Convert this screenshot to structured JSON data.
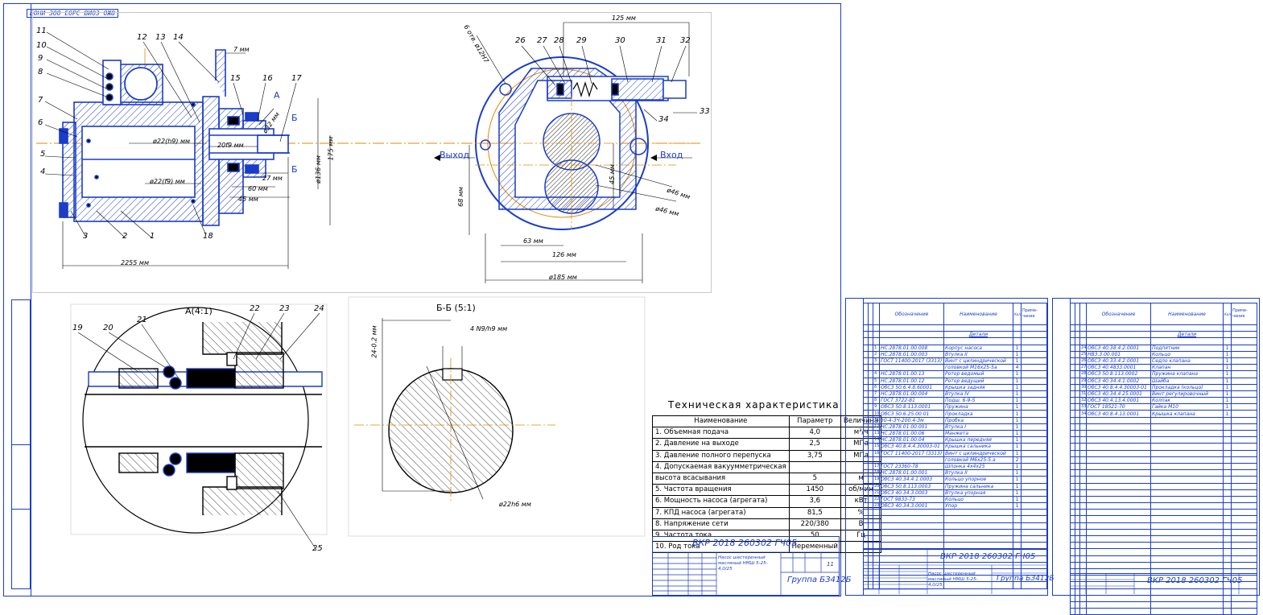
{
  "sheet_label": "БОНИ ЗОО ЕОРС ВИОЗ ОЖ8",
  "colors": {
    "frame": "#1a3cc8",
    "axis": "#e08a00",
    "hatch": "#1a3cc8"
  },
  "main_view": {
    "dims": [
      "7 мм",
      "60 мм",
      "45 мм",
      "27 мм",
      "2255 мм",
      "ø22(h9) мм",
      "ø22(f9) мм",
      "20f9 мм",
      "ø32 мм",
      "175 мм",
      "ø136 мм"
    ],
    "callouts": [
      "1",
      "2",
      "3",
      "4",
      "5",
      "6",
      "7",
      "8",
      "9",
      "10",
      "11",
      "12",
      "13",
      "14",
      "15",
      "16",
      "17",
      "18"
    ],
    "view_marks": {
      "a": "А",
      "b_top": "Б",
      "b_bottom": "Б"
    }
  },
  "section_view": {
    "dims": [
      "125 мм",
      "63 мм",
      "126 мм",
      "ø185 мм",
      "68 мм",
      "45 мм",
      "ø46 мм",
      "ø46 мм",
      "6 отв. ø12H7"
    ],
    "callouts": [
      "26",
      "27",
      "28",
      "29",
      "30",
      "31",
      "32",
      "33",
      "34"
    ],
    "labels": {
      "outlet": "Выход",
      "inlet": "Вход"
    }
  },
  "detail_a": {
    "title": "А(4:1)",
    "callouts": [
      "19",
      "20",
      "21",
      "22",
      "23",
      "24",
      "25"
    ]
  },
  "section_bb": {
    "title": "Б-Б (5:1)",
    "dims": [
      "24-0.2 мм",
      "4 N9/h9 мм",
      "ø22h6 мм"
    ]
  },
  "tech_char": {
    "title": "Техническая характеристика",
    "headers": [
      "Наименование",
      "Параметр",
      "Величина"
    ],
    "rows": [
      [
        "1. Объемная подача",
        "4,0",
        "м³/ч"
      ],
      [
        "2. Давление на выходе",
        "2,5",
        "МПа"
      ],
      [
        "3. Давление полного перепуска",
        "3,75",
        "МПа"
      ],
      [
        "4. Допускаемая вакуумметрическая",
        "",
        " "
      ],
      [
        "высота всасывания",
        "5",
        "м"
      ],
      [
        "5. Частота вращения",
        "1450",
        "об/мин"
      ],
      [
        "6. Мощность насоса (агрегата)",
        "3,6",
        "кВт"
      ],
      [
        "7. КПД насоса (агрегата)",
        "81,5",
        "%"
      ],
      [
        "8. Напряжение сети",
        "220/380",
        "В"
      ],
      [
        "9. Частота тока",
        "50",
        "Гц"
      ],
      [
        "10. Род тока",
        "Переменный",
        ""
      ]
    ]
  },
  "stamp_main": {
    "code": "ВКР 2018 260302 ГЧ05",
    "title": "Насос шестеренный масляный НМШ 5-25-4,0/25",
    "mass": "11",
    "group": "Группа БЗ412Б"
  },
  "spec1": {
    "headers": [
      "Обозначение",
      "Наименование",
      "Кол.",
      "Приме-чание"
    ],
    "section": "Детали",
    "rows": [
      [
        "1",
        "НС.2878.01.00.008",
        "Корпус насоса",
        "1"
      ],
      [
        "2",
        "НС.2878.01.00.003",
        "Втулка II",
        "1"
      ],
      [
        "3",
        "ГОСТ 11400-2017 (3313)",
        "Винт с цилиндрической",
        "1"
      ],
      [
        "",
        "",
        "головкой М16х25-5а",
        "4"
      ],
      [
        "4",
        "НС.2878.01.00.13",
        "Ротор ведомый",
        "1"
      ],
      [
        "5",
        "НС.2878.01.00.12",
        "Ротор ведущий",
        "1"
      ],
      [
        "6",
        "ОбСЗ 50.6.4.8.60001",
        "Крышка задняя",
        "1"
      ],
      [
        "7",
        "НС.2878.01.00.004",
        "Втулка IV",
        "1"
      ],
      [
        "8",
        "ГОСТ 3722-81",
        "Подш. 6-9-5",
        "1"
      ],
      [
        "9",
        "ОбСЗ 50.8.113.0001",
        "Пружина",
        "1"
      ],
      [
        "10",
        "ОбСЗ 50.6.25.00.01",
        "Прокладка",
        "1"
      ],
      [
        "11",
        "30-4-3Ч-200.4-Зм",
        "Пробка",
        "1"
      ],
      [
        "12",
        "НС.2878.01.00.001",
        "Втулка I",
        "1"
      ],
      [
        "13",
        "НС.2878.01.00.06",
        "Манжета",
        "1"
      ],
      [
        "14",
        "НС.2878.01.00.04",
        "Крышка передняя",
        "1"
      ],
      [
        "15",
        "ОбСЗ 40.8.4.4.30003-01",
        "Крышка сальника",
        "1"
      ],
      [
        "16",
        "ГОСТ 11400-2017 (3313)",
        "Винт с цилиндрической",
        "1"
      ],
      [
        "",
        "",
        "головкой М6х25-5.а",
        "2"
      ],
      [
        "17",
        "ГОСТ 23360-78",
        "Шпонка 4х4х25",
        "1"
      ],
      [
        "18",
        "НС.2878.01.00.001",
        "Втулка II",
        "1"
      ],
      [
        "19",
        "ОбСЗ 40.34.4.1.0003",
        "Кольцо упорное",
        "1"
      ],
      [
        "20",
        "ОбСЗ 50.8.113.0003",
        "Пружина сальника",
        "1"
      ],
      [
        "21",
        "ОбСЗ 40.34.3.0003",
        "Втулка упорная",
        "1"
      ],
      [
        "22",
        "ГОСТ 9833-73",
        "Кольцо",
        "1"
      ],
      [
        "23",
        "ОбСЗ 40.34.3.0001",
        "Упор",
        "1"
      ]
    ],
    "stamp_code": "ВКР 2018 260302 ГЧ05",
    "stamp_title": "Насос шестеренный масляный НМШ 5-25-4,0/25",
    "stamp_group": "Группа БЗ412Б"
  },
  "spec2": {
    "headers": [
      "Обозначение",
      "Наименование",
      "Кол.",
      "Приме-чание"
    ],
    "section": "Детали",
    "rows": [
      [
        "24",
        "ОбСЗ 40.38.4.2.0001",
        "Подпятник",
        "1"
      ],
      [
        "25",
        "НВЗ.3.00.001",
        "Кольцо",
        "1"
      ],
      [
        "26",
        "ОбСЗ 40.33.4.2.0001",
        "Седло клапана",
        "1"
      ],
      [
        "27",
        "ОбСЗ 40.4833.0001",
        "Клапан",
        "1"
      ],
      [
        "28",
        "ОбСЗ 50.8.113.0002",
        "Пружина клапана",
        "1"
      ],
      [
        "29",
        "ОбСЗ 40.34.4.1.0002",
        "Шайба",
        "1"
      ],
      [
        "30",
        "ОбСЗ 40.8.4.4.30003-01",
        "Прокладка (кольцо)",
        "1"
      ],
      [
        "31",
        "ОбСЗ 40.34.4.25.0001",
        "Винт регулировочный",
        "1"
      ],
      [
        "32",
        "ОбСЗ 40.4.13.4.0001",
        "Колпак",
        "1"
      ],
      [
        "33",
        "ГОСТ 18521-70",
        "Гайка М10",
        "1"
      ],
      [
        "34",
        "ОбСЗ 40.8.4.13.0001",
        "Крышка клапана",
        "1"
      ]
    ],
    "stamp_code": "ВКР 2018 260302 ГЧ05"
  }
}
